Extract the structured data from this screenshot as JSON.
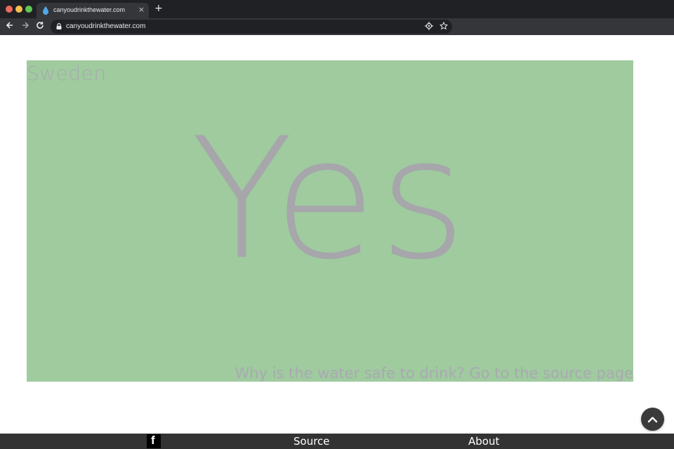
{
  "browser": {
    "tab_title": "canyoudrinkthewater.com",
    "tab_close": "×",
    "new_tab": "+",
    "url": "canyoudrinkthewater.com",
    "icons": [
      "back-arrow-icon",
      "forward-arrow-icon",
      "reload-icon",
      "lock-icon",
      "location-target-icon",
      "star-icon"
    ]
  },
  "answer": {
    "country": "Sweden",
    "verdict": "Yes",
    "source_link": "Why is the water safe to drink? Go to the source page",
    "panel_color": "#9fcb9f",
    "text_color": "#a6a6ab"
  },
  "scroll_top": {
    "icon": "chevron-up-icon"
  },
  "footer": {
    "facebook_icon": "f",
    "source_label": "Source",
    "about_label": "About"
  }
}
